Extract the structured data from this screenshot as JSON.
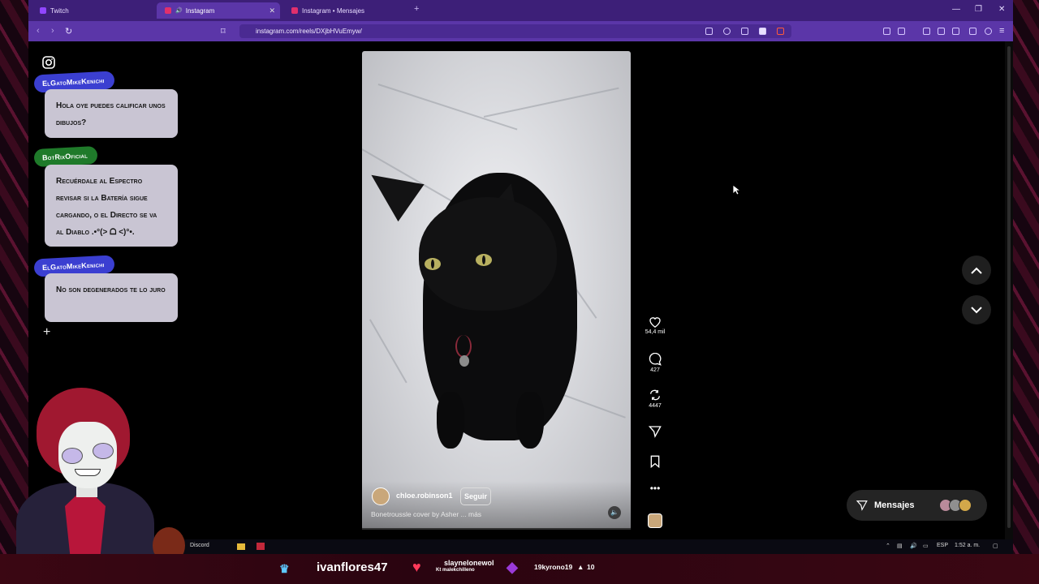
{
  "tabs": [
    {
      "label": "Twitch",
      "active": false
    },
    {
      "label": "Instagram",
      "active": true
    },
    {
      "label": "Instagram • Mensajes",
      "active": false
    }
  ],
  "address": {
    "url": "instagram.com/reels/DXjbHVuEmyw/"
  },
  "reel": {
    "username": "chloe.robinson1",
    "follow_label": "Seguir",
    "caption": "Bonetroussle cover by Asher ... más",
    "progress": 0.0
  },
  "actions": {
    "likes": "54,4 mil",
    "comments": "427",
    "reposts": "4447"
  },
  "messages": {
    "label": "Mensajes"
  },
  "chat": [
    {
      "user": "ElGatoMikeKenichi",
      "text": "Hola oye puedes calificar unos dibujos?",
      "badge_color": "#3b3fd1"
    },
    {
      "user": "BotRixOficial",
      "text": "Recuérdale al Espectro revisar si la Batería sigue cargando, o el Directo se va al Diablo .•°(> ᗝ <)°•.",
      "badge_color": "#1f7a2a"
    },
    {
      "user": "ElGatoMikeKenichi",
      "text": "No son degenerados te lo juro",
      "badge_color": "#3b3fd1"
    }
  ],
  "taskbar": {
    "discord": "Discord",
    "lang": "ESP",
    "time": "1:52 a. m."
  },
  "banner": {
    "user": "ivanflores47",
    "heart_user": "slaynelonewol",
    "heart_sub": "Kt malekchilleno",
    "gem_user": "19kyrono19",
    "gem_count": "10"
  },
  "colors": {
    "tabbar": "#3d1f78",
    "addrbar": "#5b36a8",
    "accent": "#e1306c"
  }
}
